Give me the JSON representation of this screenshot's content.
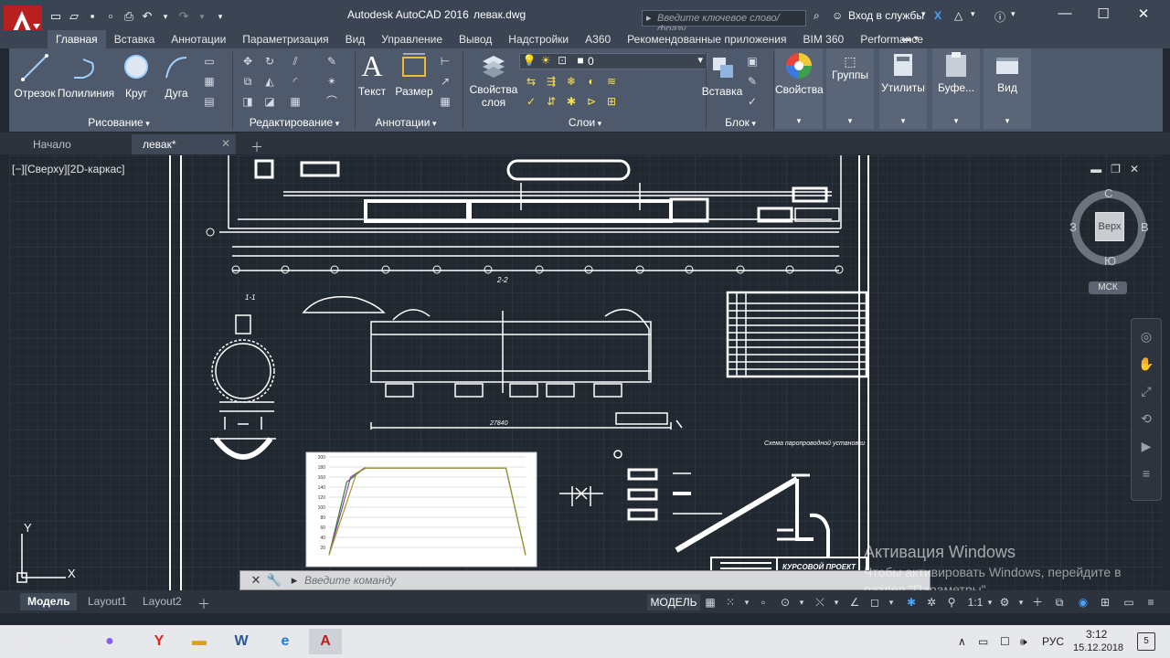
{
  "titlebar": {
    "app_name": "Autodesk AutoCAD 2016",
    "file_name": "левак.dwg",
    "search_placeholder": "Введите ключевое слово/фразу",
    "signin_label": "Вход в службы"
  },
  "ribbon_tabs": [
    "Главная",
    "Вставка",
    "Аннотации",
    "Параметризация",
    "Вид",
    "Управление",
    "Вывод",
    "Надстройки",
    "A360",
    "Рекомендованные приложения",
    "BIM 360",
    "Performance"
  ],
  "ribbon": {
    "draw": {
      "line": "Отрезок",
      "polyline": "Полилиния",
      "circle": "Круг",
      "arc": "Дуга",
      "title": "Рисование"
    },
    "modify": {
      "title": "Редактирование"
    },
    "annotation": {
      "text": "Текст",
      "dimension": "Размер",
      "title": "Аннотации"
    },
    "layers": {
      "properties_line1": "Свойства",
      "properties_line2": "слоя",
      "current_layer": "0",
      "title": "Слои"
    },
    "block": {
      "insert": "Вставка",
      "title": "Блок"
    },
    "properties": {
      "label": "Свойства"
    },
    "groups": {
      "label": "Группы"
    },
    "utilities": {
      "label": "Утилиты"
    },
    "clipboard": {
      "label": "Буфе..."
    },
    "view": {
      "label": "Вид"
    }
  },
  "file_tabs": {
    "start": "Начало",
    "drawing": "левак*"
  },
  "viewport": {
    "label": "[−][Сверху][2D-каркас]",
    "viewcube": {
      "face": "Верх",
      "north": "С",
      "south": "Ю",
      "west": "З",
      "east": "В",
      "ucs": "МСК"
    },
    "axis_y": "Y",
    "axis_x": "X"
  },
  "chart_data": {
    "type": "line",
    "y_ticks": [
      20,
      40,
      60,
      80,
      100,
      120,
      140,
      160,
      180,
      200
    ],
    "ylim": [
      0,
      200
    ],
    "series": [
      {
        "points": [
          [
            0,
            5
          ],
          [
            0.9,
            150
          ],
          [
            1.8,
            178
          ],
          [
            9,
            178
          ],
          [
            10,
            5
          ]
        ]
      },
      {
        "points": [
          [
            0,
            5
          ],
          [
            1.1,
            160
          ],
          [
            1.8,
            178
          ],
          [
            9,
            178
          ],
          [
            10,
            5
          ]
        ]
      },
      {
        "points": [
          [
            0,
            5
          ],
          [
            1.4,
            168
          ],
          [
            1.9,
            178
          ],
          [
            9,
            178
          ],
          [
            10,
            5
          ]
        ]
      }
    ]
  },
  "drawing_texts": {
    "title_block": "КУРСОВОЙ ПРОЕКТ",
    "section_a": "1-1",
    "section_b": "2-2",
    "dimension": "27840",
    "scheme_caption": "Схема паропроводной установки"
  },
  "command_line": {
    "placeholder": "Введите команду"
  },
  "layout_tabs": [
    "Модель",
    "Layout1",
    "Layout2"
  ],
  "statusbar": {
    "model": "МОДЕЛЬ",
    "scale": "1:1"
  },
  "activation": {
    "title": "Активация Windows",
    "line1": "Чтобы активировать Windows, перейдите в",
    "line2": "раздел \"Параметры\"."
  },
  "taskbar": {
    "lang": "РУС",
    "time": "3:12",
    "date": "15.12.2018",
    "notif_count": "5"
  }
}
